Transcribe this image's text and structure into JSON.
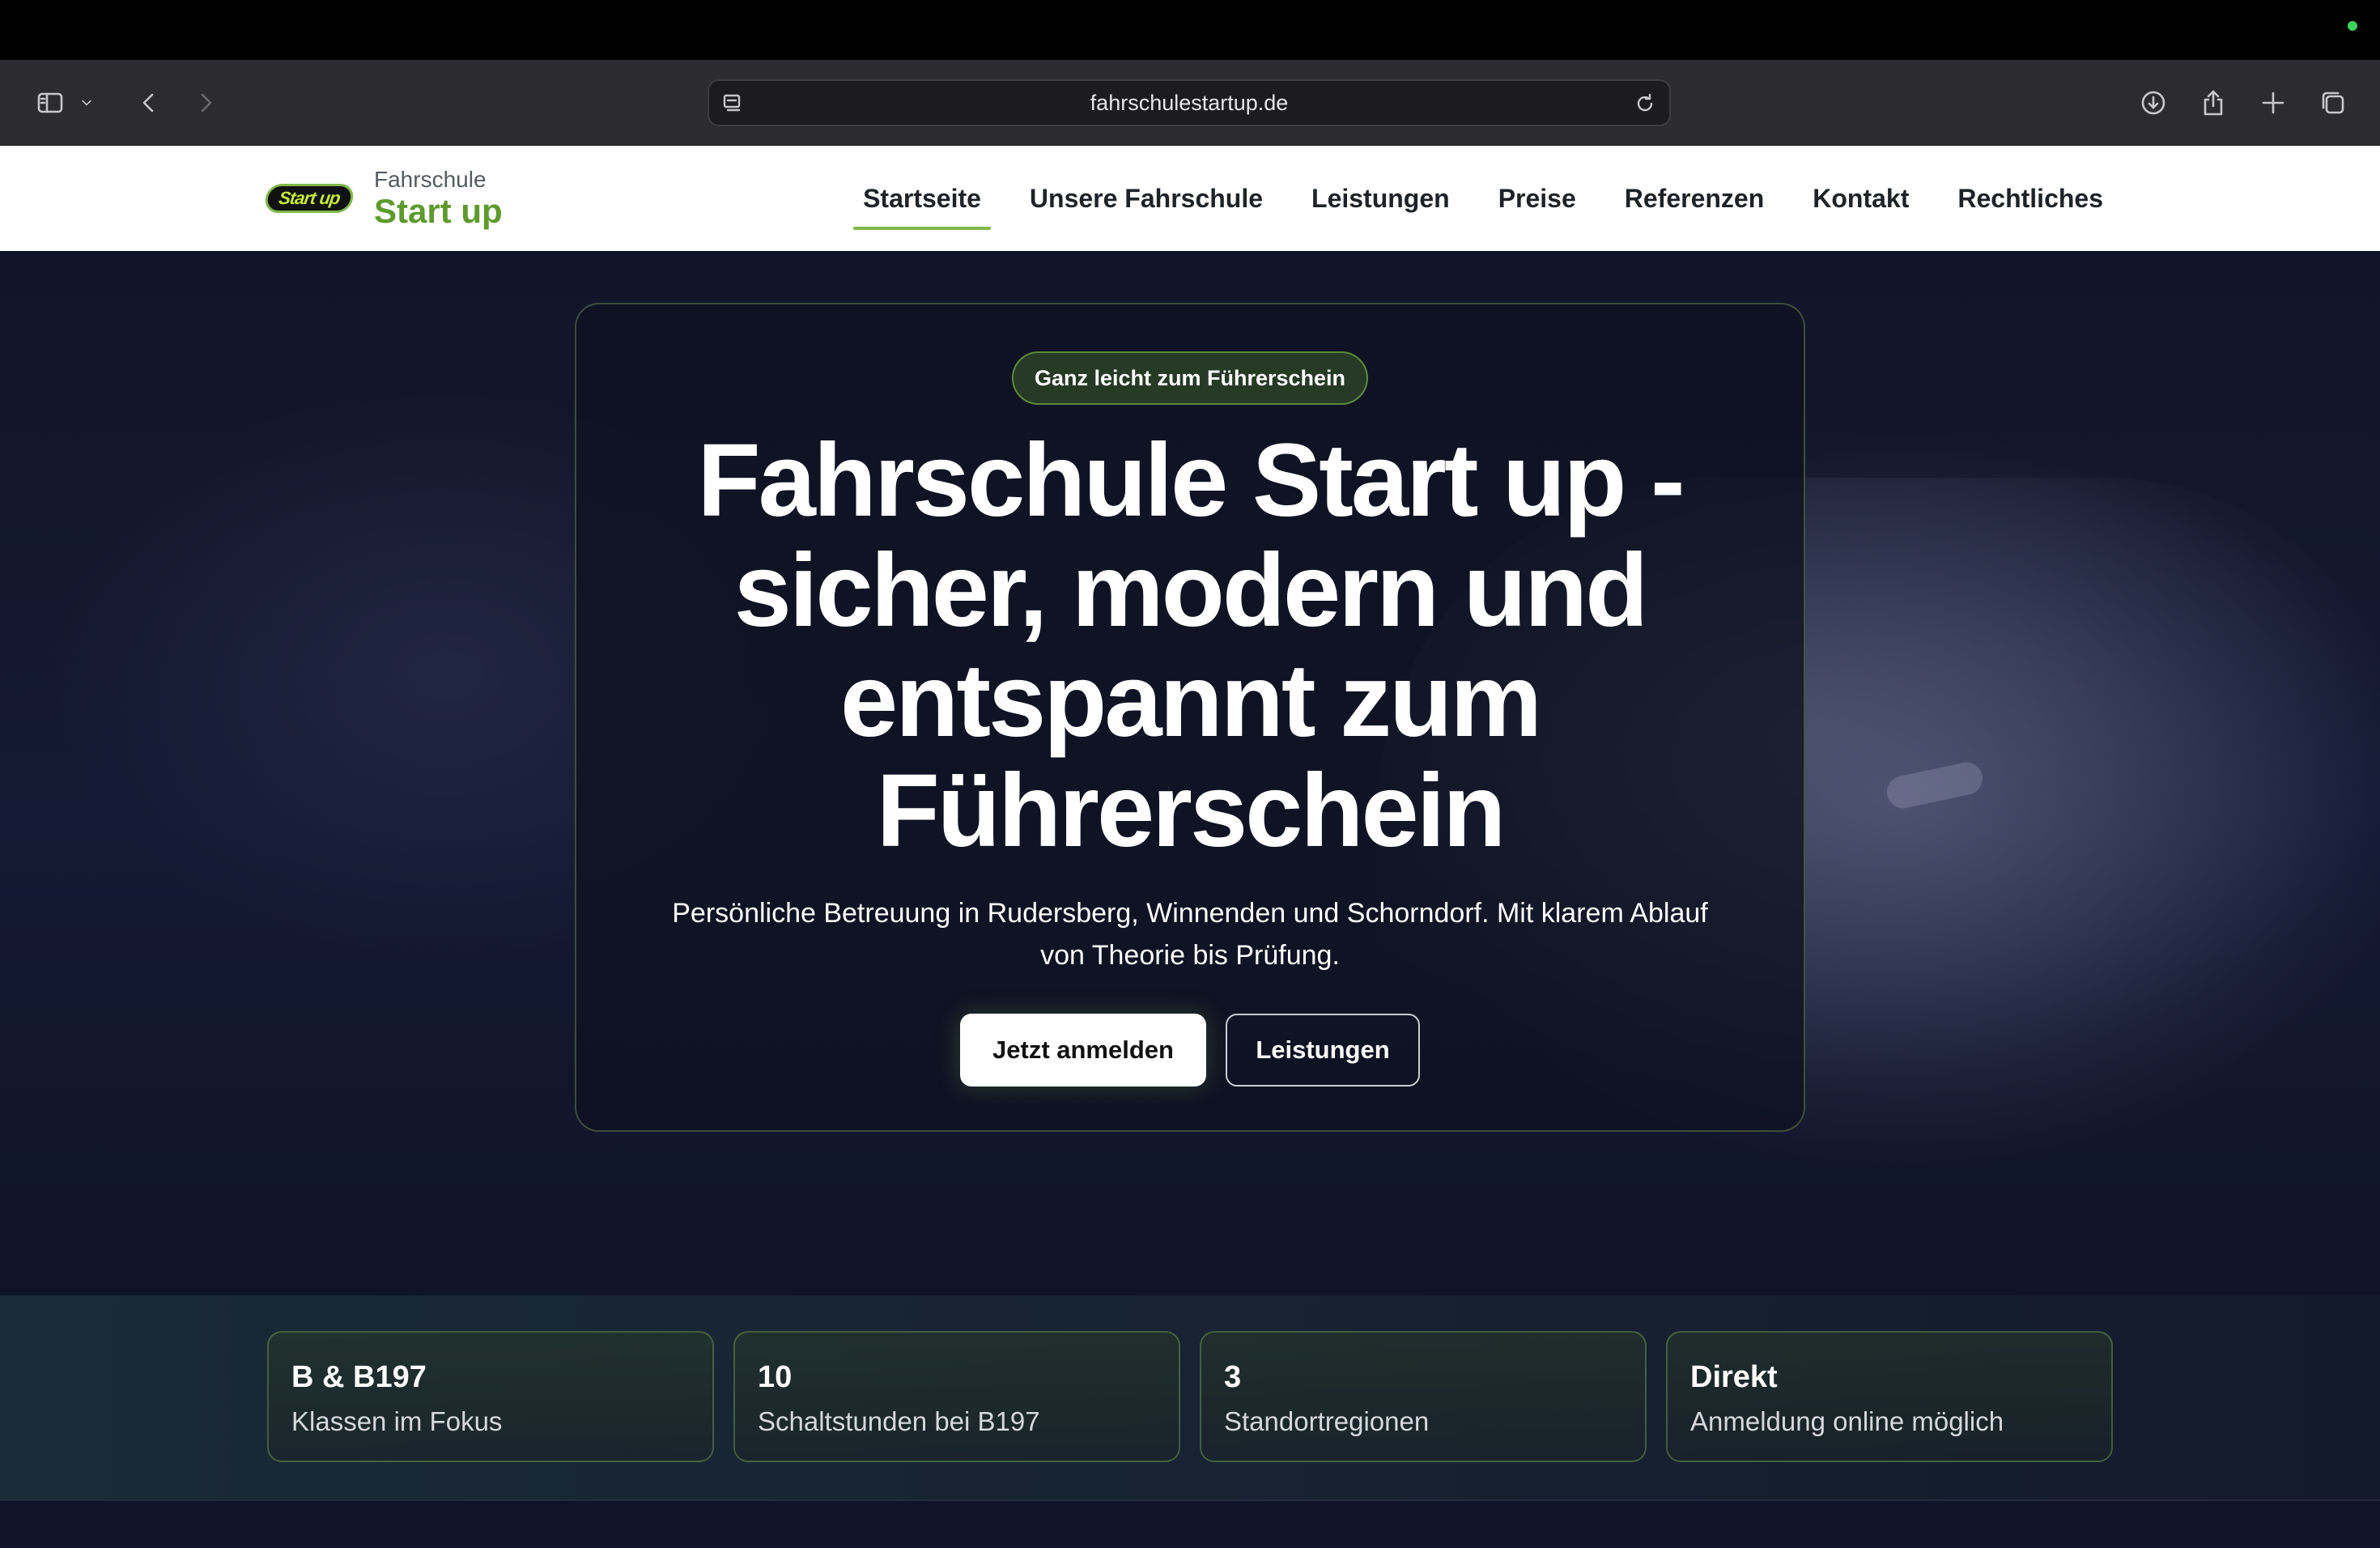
{
  "browser": {
    "url": "fahrschulestartup.de"
  },
  "site": {
    "logo_badge": "Start up",
    "logo_small": "Fahrschule",
    "logo_big": "Start up",
    "nav": [
      {
        "label": "Startseite",
        "active": true
      },
      {
        "label": "Unsere Fahrschule",
        "active": false
      },
      {
        "label": "Leistungen",
        "active": false
      },
      {
        "label": "Preise",
        "active": false
      },
      {
        "label": "Referenzen",
        "active": false
      },
      {
        "label": "Kontakt",
        "active": false
      },
      {
        "label": "Rechtliches",
        "active": false
      }
    ]
  },
  "hero": {
    "tag": "Ganz leicht zum Führerschein",
    "title": "Fahrschule Start up - sicher, modern und entspannt zum Führerschein",
    "subtitle": "Persönliche Betreuung in Rudersberg, Winnenden und Schorndorf. Mit klarem Ablauf von Theorie bis Prüfung.",
    "primary_button": "Jetzt anmelden",
    "secondary_button": "Leistungen"
  },
  "stats": [
    {
      "value": "B & B197",
      "label": "Klassen im Fokus"
    },
    {
      "value": "10",
      "label": "Schaltstunden bei B197"
    },
    {
      "value": "3",
      "label": "Standortregionen"
    },
    {
      "value": "Direkt",
      "label": "Anmeldung online möglich"
    }
  ],
  "colors": {
    "accent_green": "#7fb84a",
    "logo_green": "#5e9a2e",
    "hero_bg": "#141a33"
  }
}
